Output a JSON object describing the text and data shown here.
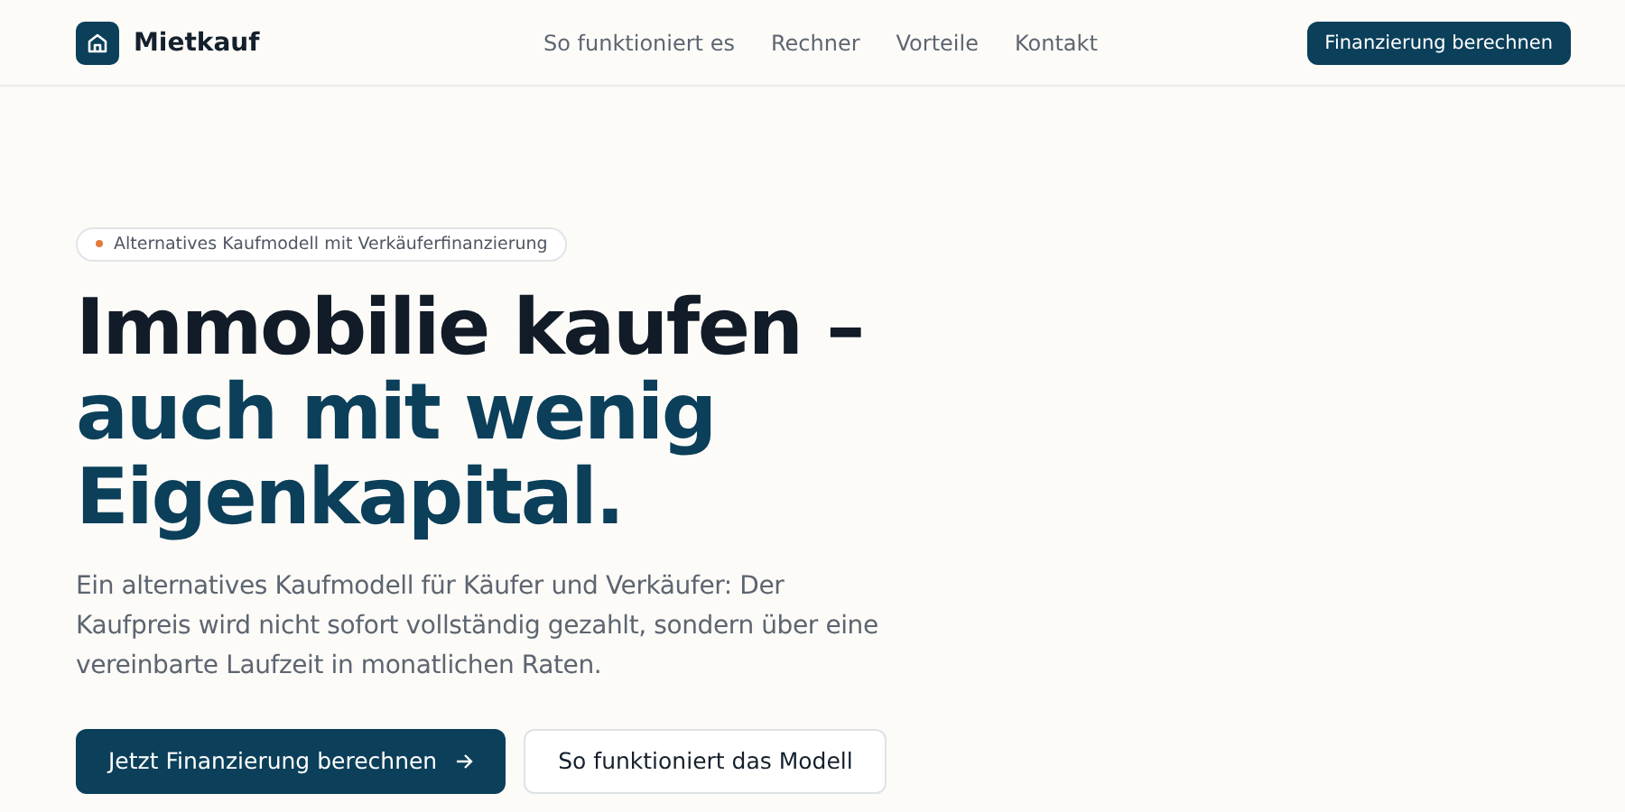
{
  "header": {
    "brand": "Mietkauf",
    "nav": [
      "So funktioniert es",
      "Rechner",
      "Vorteile",
      "Kontakt"
    ],
    "cta": "Finanzierung berechnen"
  },
  "hero": {
    "badge": "Alternatives Kaufmodell mit Verkäuferfinanzierung",
    "headline": [
      {
        "text": "Immobilie kaufen –",
        "accent": false
      },
      {
        "text": "auch mit wenig",
        "accent": true
      },
      {
        "text": "Eigenkapital.",
        "accent": true
      }
    ],
    "lead": "Ein alternatives Kaufmodell für Käufer und Verkäufer: Der Kaufpreis wird nicht sofort vollständig gezahlt, sondern über eine vereinbarte Laufzeit in monatlichen Raten.",
    "buttons": [
      {
        "label": "Jetzt Finanzierung berechnen",
        "kind": "primary"
      },
      {
        "label": "So funktioniert das Modell",
        "kind": "secondary"
      }
    ]
  }
}
